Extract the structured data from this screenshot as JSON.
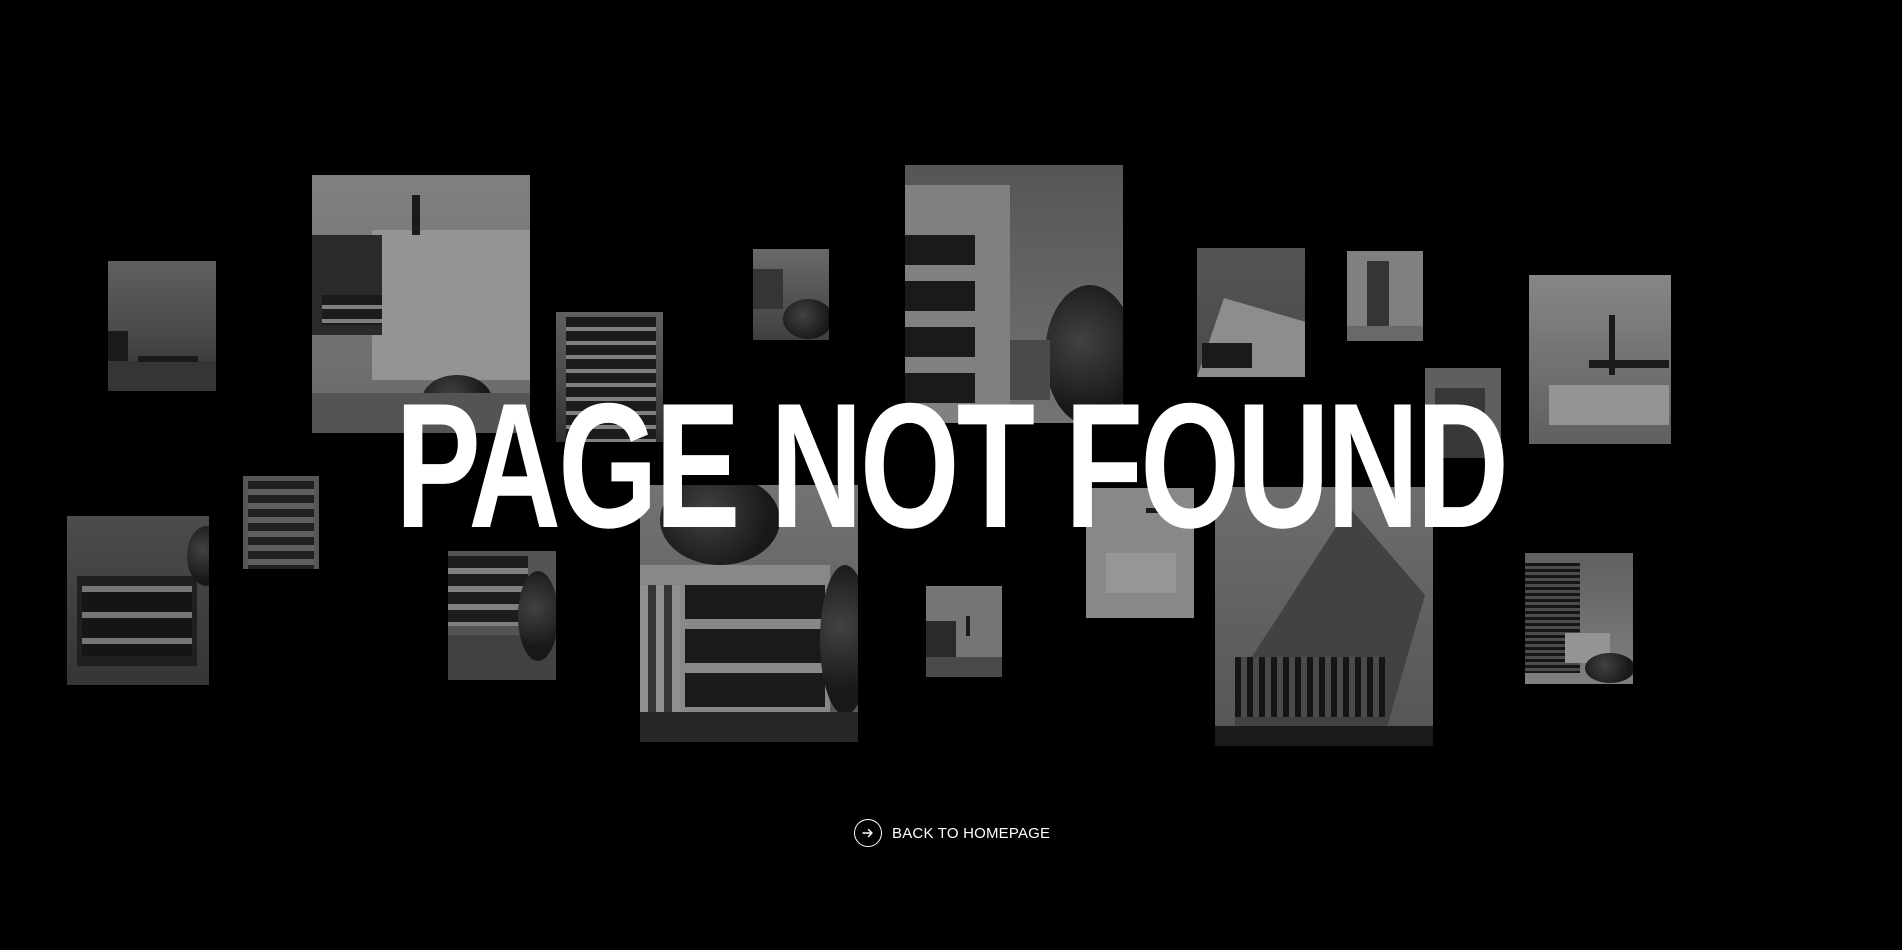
{
  "page": {
    "background_color": "#000000",
    "headline": "PAGE NOT FOUND",
    "text_color": "#ffffff"
  },
  "back_link": {
    "label": "BACK TO HOMEPAGE",
    "icon": "arrow-right-circle-icon"
  },
  "photos": [
    {
      "subject": "terrace-view"
    },
    {
      "subject": "white-villa-balcony"
    },
    {
      "subject": "apartment-block-balconies"
    },
    {
      "subject": "rooftop-view"
    },
    {
      "subject": "apartment-tower-corner"
    },
    {
      "subject": "angular-white-facade"
    },
    {
      "subject": "interior-doorway"
    },
    {
      "subject": "interior-kitchen"
    },
    {
      "subject": "narrow-interior"
    },
    {
      "subject": "brick-building"
    },
    {
      "subject": "townhouse-night"
    },
    {
      "subject": "apartment-with-garden"
    },
    {
      "subject": "modern-apartment-trees"
    },
    {
      "subject": "interior-living"
    },
    {
      "subject": "kitchen-island"
    },
    {
      "subject": "angular-brick-building"
    },
    {
      "subject": "wood-slat-facade"
    }
  ]
}
